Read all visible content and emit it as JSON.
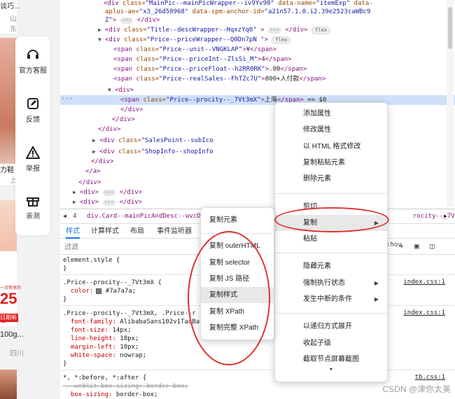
{
  "shop": {
    "top_text": "谈巧...",
    "top_city": "山东",
    "food_label": "力鞋",
    "food_label_sub": "上",
    "promo_badge": "25",
    "promo_unit": "包",
    "promo_top": "一月畅享的",
    "promo_new": "日期新鲜",
    "weight": "100g...",
    "city2": "四川",
    "service_items": [
      {
        "label": "官方客服",
        "icon": "headset-icon"
      },
      {
        "label": "反馈",
        "icon": "edit-icon"
      },
      {
        "label": "举报",
        "icon": "warning-icon"
      },
      {
        "label": "亲测",
        "icon": "gift-icon"
      }
    ]
  },
  "dom": {
    "lines": [
      {
        "indent": 148,
        "tri": "",
        "html": "<span class=\"tag\">&lt;div</span> <span class=\"attr\">class=</span><span class=\"val\">\"MainPic--mainPicWrapper--iv9Yv90\"</span> <span class=\"attr\">data-name=</span><span class=\"val\">\"itemExp\"</span> <span class=\"attr\">data-</span>"
      },
      {
        "indent": 150,
        "tri": "",
        "html": "<span class=\"attr\">aplus-ae=</span><span class=\"val\">\"x3_26d58968\"</span> <span class=\"attr\">data-spm-anchor-id=</span><span class=\"val\">\"a21n57.1.0.i2.39e2523caWBc9</span>"
      },
      {
        "indent": 150,
        "tri": "",
        "html": "<span class=\"val\">Z\"</span><span class=\"tag\">&gt;</span> <span class=\"dots\">···</span> <span class=\"tag\">&lt;/div&gt;</span>"
      },
      {
        "indent": 140,
        "tri": "▶",
        "html": "<span class=\"tag\">&lt;div</span> <span class=\"attr\">class=</span><span class=\"val\">\"Title--descWrapper--HqxzYq0\"</span> <span class=\"tag\">&gt;</span> <span class=\"dots\">···</span> <span class=\"tag\">&lt;/div&gt;</span> <span class=\"pill\">flex</span>"
      },
      {
        "indent": 140,
        "tri": "▼",
        "html": "<span class=\"tag\">&lt;div</span> <span class=\"attr\">class=</span><span class=\"val\">\"Price--priceWrapper--Q0Dn7pN \"</span><span class=\"tag\">&gt;</span> <span class=\"pill\">flex</span>"
      },
      {
        "indent": 162,
        "tri": "",
        "html": "<span class=\"tag\">&lt;span</span> <span class=\"attr\">class=</span><span class=\"val\">\"Price--unit--VNGKLAP\"</span><span class=\"tag\">&gt;</span><span class=\"txt\">¥</span><span class=\"tag\">&lt;/span&gt;</span>"
      },
      {
        "indent": 162,
        "tri": "",
        "html": "<span class=\"tag\">&lt;span</span> <span class=\"attr\">class=</span><span class=\"val\">\"Price--priceInt--ZlsSi_M\"</span><span class=\"tag\">&gt;</span><span class=\"txt\">4</span><span class=\"tag\">&lt;/span&gt;</span>"
      },
      {
        "indent": 162,
        "tri": "",
        "html": "<span class=\"tag\">&lt;span</span> <span class=\"attr\">class=</span><span class=\"val\">\"Price--priceFloat--h2RR0RK\"</span><span class=\"tag\">&gt;</span><span class=\"txt\">.00</span><span class=\"tag\">&lt;/span&gt;</span>"
      },
      {
        "indent": 162,
        "tri": "",
        "html": "<span class=\"tag\">&lt;span</span> <span class=\"attr\">class=</span><span class=\"val\">\"Price--realSales--FhTZc7U\"</span><span class=\"tag\">&gt;</span><span class=\"txt\">800+人付款</span><span class=\"tag\">&lt;/span&gt;</span>"
      },
      {
        "indent": 154,
        "tri": "▼",
        "html": "<span class=\"tag\">&lt;div&gt;</span>"
      },
      {
        "indent": 172,
        "tri": "",
        "html": "<span class=\"tag\">&lt;span</span> <span class=\"attr\">class=</span><span class=\"val\">\"Price--procity--_7Vt3mX\"</span><span class=\"tag\">&gt;</span><span class=\"txt\">上海</span><span class=\"tag\">&lt;/span&gt;</span> <span class=\"txt\">== $0</span>",
        "selected": true
      },
      {
        "indent": 172,
        "tri": "",
        "html": "<span class=\"tag\">&lt;/div&gt;</span>"
      },
      {
        "indent": 160,
        "tri": "",
        "html": "<span class=\"tag\">&lt;/div&gt;</span>"
      },
      {
        "indent": 140,
        "tri": "",
        "html": "<span class=\"tag\">&lt;/div&gt;</span>"
      },
      {
        "indent": 132,
        "tri": "▶",
        "html": "<span class=\"tag\">&lt;div</span> <span class=\"attr\">class=</span><span class=\"val\">\"SalesPoint--subIco</span>"
      },
      {
        "indent": 132,
        "tri": "▶",
        "html": "<span class=\"tag\">&lt;div</span> <span class=\"attr\">class=</span><span class=\"val\">\"ShopInfo--shopInfo</span>"
      },
      {
        "indent": 130,
        "tri": "",
        "html": "<span class=\"tag\">&lt;/div&gt;</span>"
      },
      {
        "indent": 122,
        "tri": "",
        "html": "<span class=\"tag\">&lt;/a&gt;</span>"
      },
      {
        "indent": 112,
        "tri": "",
        "html": "<span class=\"tag\">&lt;/div&gt;</span>"
      },
      {
        "indent": 104,
        "tri": "▶",
        "html": "<span class=\"tag\">&lt;div&gt;</span> <span class=\"dots\">···</span> <span class=\"tag\">&lt;/div&gt;</span>"
      },
      {
        "indent": 104,
        "tri": "▶",
        "html": "<span class=\"tag\">&lt;div&gt;</span> <span class=\"dots\">···</span> <span class=\"tag\">&lt;/div&gt;</span>"
      },
      {
        "indent": 104,
        "tri": "▶",
        "html": "<span class=\"tag\">&lt;div&gt;</span> <span class=\"dots\">···</span> <span class=\"tag\">&lt;/div&gt;</span>"
      }
    ],
    "gutter_dots": "···",
    "flex_badge": "flex"
  },
  "breadcrumb": {
    "item1": "4",
    "item2": "div.Card--mainPicAndDesc--wvcDXa",
    "item3": "rocity--_7Vt3mX"
  },
  "styles_tabs": [
    "样式",
    "计算样式",
    "布局",
    "事件监听器"
  ],
  "filter": {
    "placeholder": "过滤",
    "toggle_states": ":hov",
    "add_rule": "+"
  },
  "rules": [
    {
      "selector": "element.style {",
      "lines": [
        "}"
      ]
    },
    {
      "selector": ".Price--procity--_7Vt3mX {",
      "source": "index.css:1",
      "lines": [
        "  color: #7a7a7a;",
        "}"
      ]
    },
    {
      "selector": ".Price--procity--_7Vt3mX, .Price--r",
      "source": "index.css:1",
      "lines": [
        "  font-family: AlibabaSans102v1TaoBao",
        "  font-size: 14px;",
        "  line-height: 18px;",
        "  margin-left: 10px;",
        "  white-space: nowrap;",
        "}"
      ]
    },
    {
      "selector": "*, *:before, *:after {",
      "source": "tb.css:1",
      "lines": [
        "  -webkit-box-sizing: border-box;",
        "  box-sizing: border-box;"
      ]
    }
  ],
  "menu_main": {
    "items": [
      {
        "label": "添加属性"
      },
      {
        "label": "修改属性"
      },
      {
        "label": "以 HTML 格式修改"
      },
      {
        "label": "复制粘贴元素"
      },
      {
        "label": "删除元素"
      },
      {
        "sep": true
      },
      {
        "label": "剪切"
      },
      {
        "label": "复制",
        "arrow": true,
        "hover": true
      },
      {
        "label": "粘贴"
      },
      {
        "sep": true
      },
      {
        "label": "隐藏元素"
      },
      {
        "label": "强制执行状态",
        "arrow": true
      },
      {
        "label": "发生中断的条件",
        "arrow": true
      },
      {
        "sep": true
      },
      {
        "label": "以递归方式展开"
      },
      {
        "label": "收起子级"
      },
      {
        "label": "截取节点屏幕截图"
      }
    ],
    "more": "▾"
  },
  "menu_sub": {
    "items": [
      {
        "label": "复制元素"
      },
      {
        "sep": true
      },
      {
        "label": "复制 outerHTML"
      },
      {
        "label": "复制 selector"
      },
      {
        "label": "复制 JS 路径"
      },
      {
        "label": "复制样式",
        "hover": true
      },
      {
        "label": "复制 XPath"
      },
      {
        "label": "复制完整 XPath"
      }
    ]
  },
  "watermark": "CSDN @津你太美",
  "colors": {
    "annotation": "#e0322e",
    "selected_row": "#cfe0f8",
    "tab_active": "#1a73e8"
  }
}
